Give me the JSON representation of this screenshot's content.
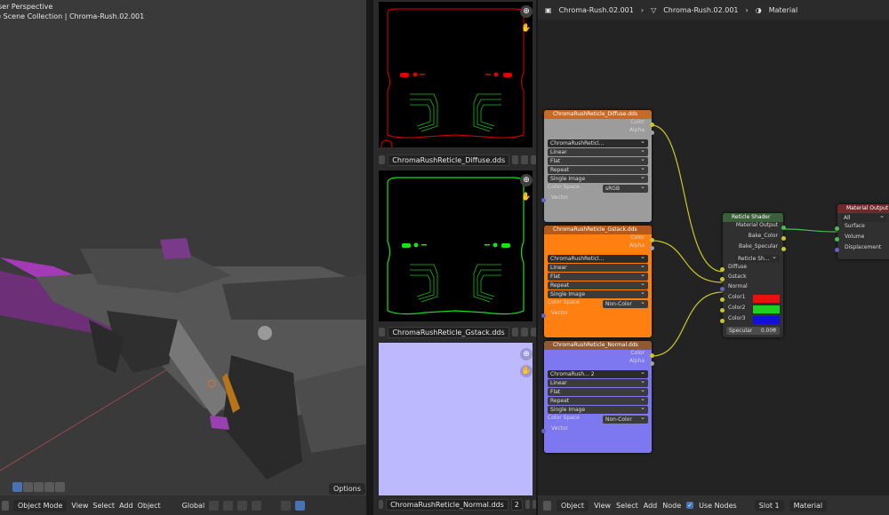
{
  "viewport": {
    "overlay_line1": "ser Perspective",
    "overlay_line2": ") Scene Collection | Chroma-Rush.02.001",
    "mode": "Object Mode",
    "menus": [
      "View",
      "Select",
      "Add",
      "Object"
    ],
    "transform_orientation": "Global",
    "options": "Options"
  },
  "image_editors": [
    {
      "name": "ChromaRushReticle_Diffuse.dds",
      "color": "#e00000"
    },
    {
      "name": "ChromaRushReticle_Gstack.dds",
      "color": "#19e019"
    },
    {
      "name": "ChromaRushReticle_Normal.dds",
      "users": "2",
      "color": "#bcb9ff"
    }
  ],
  "node_editor": {
    "breadcrumb": [
      "Chroma-Rush.02.001",
      "Chroma-Rush.02.001",
      "Material"
    ],
    "bottom": {
      "mode": "Object",
      "menus": [
        "View",
        "Select",
        "Add",
        "Node"
      ],
      "use_nodes": "Use Nodes",
      "slot": "Slot 1",
      "material": "Material"
    },
    "texture_nodes": [
      {
        "title": "ChromaRushReticle_Diffuse.dds",
        "image": "ChromaRushReticl...",
        "interp": "Linear",
        "proj": "Flat",
        "ext": "Repeat",
        "source": "Single Image",
        "cs_label": "Color Space",
        "cs_value": "sRGB",
        "out_color": "Color",
        "out_alpha": "Alpha",
        "in_vector": "Vector",
        "head": "#c46a2a",
        "body": "#9c9c9c"
      },
      {
        "title": "ChromaRushReticle_Gstack.dds",
        "image": "ChromaRushReticl...",
        "interp": "Linear",
        "proj": "Flat",
        "ext": "Repeat",
        "source": "Single Image",
        "cs_label": "Color Space",
        "cs_value": "Non-Color",
        "out_color": "Color",
        "out_alpha": "Alpha",
        "in_vector": "Vector",
        "head": "#b55a1a",
        "body": "#ff7f10"
      },
      {
        "title": "ChromaRushReticle_Normal.dds",
        "image": "ChromaRush...",
        "users": "2",
        "interp": "Linear",
        "proj": "Flat",
        "ext": "Repeat",
        "source": "Single Image",
        "cs_label": "Color Space",
        "cs_value": "Non-Color",
        "out_color": "Color",
        "out_alpha": "Alpha",
        "in_vector": "Vector",
        "head": "#8f5a33",
        "body": "#7d78f0"
      }
    ],
    "shader_node": {
      "title": "Reticle Shader",
      "out_material": "Material Output",
      "out_bake_color": "Bake_Color",
      "out_bake_specular": "Bake_Specular",
      "group": "Reticle Sh...",
      "in_diffuse": "Diffuse",
      "in_gstack": "Gstack",
      "in_normal": "Normal",
      "color1": "Color1",
      "color1_hex": "#e81010",
      "color2": "Color2",
      "color2_hex": "#1ed11e",
      "color3": "Color3",
      "color3_hex": "#1010d8",
      "specular": "Specular",
      "specular_value": "0.000"
    },
    "output_node": {
      "title": "Material Output",
      "target": "All",
      "in_surface": "Surface",
      "in_volume": "Volume",
      "in_displacement": "Displacement"
    }
  }
}
